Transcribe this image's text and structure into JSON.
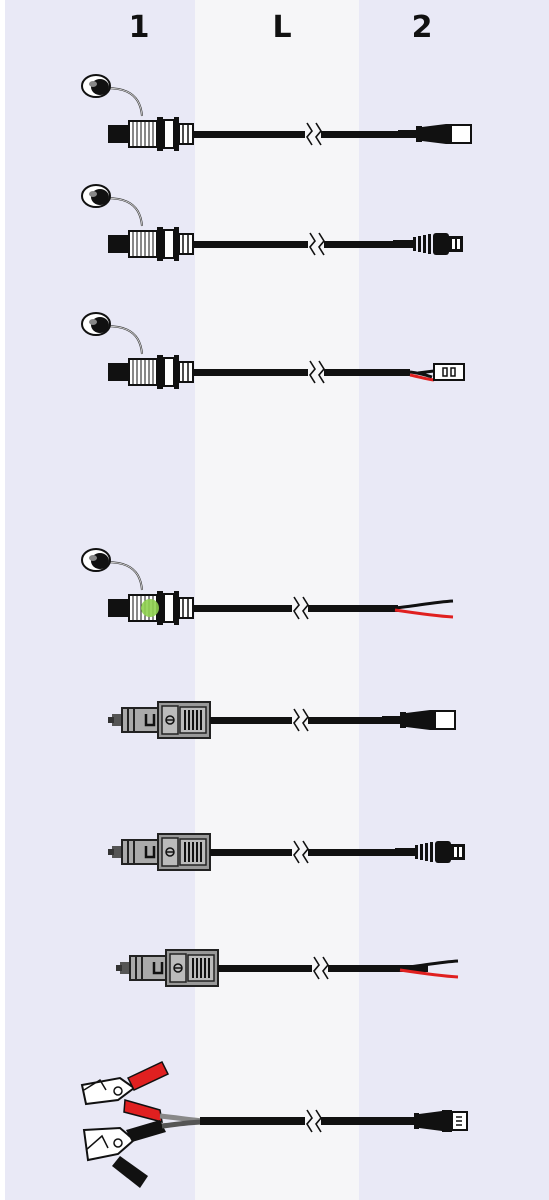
{
  "header": {
    "col1": "1",
    "colL": "L",
    "col2": "2"
  },
  "rows": [
    {
      "id": "row-1",
      "end1": "circular-socket-with-cap",
      "end2": "box-connector"
    },
    {
      "id": "row-2",
      "end1": "circular-socket-with-cap",
      "end2": "ribbed-plug"
    },
    {
      "id": "row-3",
      "end1": "circular-socket-with-cap",
      "end2": "red-black-wire-terminal"
    },
    {
      "id": "row-4",
      "end1": "circular-socket-with-cap-green-led",
      "end2": "bare-red-black-wires"
    },
    {
      "id": "row-5",
      "end1": "cigarette-lighter-plug",
      "end2": "box-connector"
    },
    {
      "id": "row-6",
      "end1": "cigarette-lighter-plug",
      "end2": "ribbed-plug"
    },
    {
      "id": "row-7",
      "end1": "cigarette-lighter-plug",
      "end2": "bare-red-black-wires"
    },
    {
      "id": "row-8",
      "end1": "battery-alligator-clamps",
      "end2": "flat-plug"
    }
  ],
  "colors": {
    "column-tint": "#e9e9f6",
    "middle-column": "#f6f6f8",
    "cable": "#111111",
    "red-wire": "#e02020",
    "led": "#8fd14f"
  }
}
